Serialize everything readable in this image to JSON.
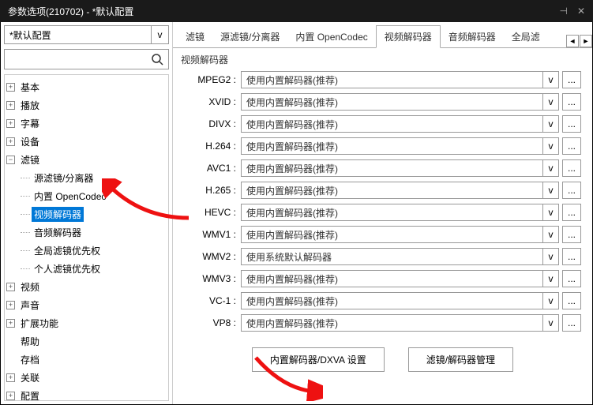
{
  "window": {
    "title": "参数选项(210702) - *默认配置"
  },
  "config_select": {
    "text": "*默认配置",
    "dropdown": "v"
  },
  "search": {
    "placeholder": ""
  },
  "tree": {
    "items": [
      {
        "toggle": "+",
        "label": "基本"
      },
      {
        "toggle": "+",
        "label": "播放"
      },
      {
        "toggle": "+",
        "label": "字幕"
      },
      {
        "toggle": "+",
        "label": "设备"
      },
      {
        "toggle": "−",
        "label": "滤镜",
        "children": [
          {
            "label": "源滤镜/分离器"
          },
          {
            "label": "内置 OpenCodec"
          },
          {
            "label": "视频解码器",
            "selected": true
          },
          {
            "label": "音频解码器"
          },
          {
            "label": "全局滤镜优先权"
          },
          {
            "label": "个人滤镜优先权"
          }
        ]
      },
      {
        "toggle": "+",
        "label": "视频"
      },
      {
        "toggle": "+",
        "label": "声音"
      },
      {
        "toggle": "+",
        "label": "扩展功能"
      },
      {
        "toggle": "",
        "label": "帮助"
      },
      {
        "toggle": "",
        "label": "存档"
      },
      {
        "toggle": "+",
        "label": "关联"
      },
      {
        "toggle": "+",
        "label": "配置"
      }
    ]
  },
  "tabs": {
    "items": [
      {
        "label": "滤镜"
      },
      {
        "label": "源滤镜/分离器"
      },
      {
        "label": "内置 OpenCodec"
      },
      {
        "label": "视频解码器",
        "active": true
      },
      {
        "label": "音频解码器"
      },
      {
        "label": "全局滤"
      }
    ],
    "scroll_left": "◄",
    "scroll_right": "►"
  },
  "section_title": "视频解码器",
  "decoders": [
    {
      "label": "MPEG2 :",
      "value": "使用内置解码器(推荐)"
    },
    {
      "label": "XVID :",
      "value": "使用内置解码器(推荐)"
    },
    {
      "label": "DIVX :",
      "value": "使用内置解码器(推荐)"
    },
    {
      "label": "H.264 :",
      "value": "使用内置解码器(推荐)"
    },
    {
      "label": "AVC1 :",
      "value": "使用内置解码器(推荐)"
    },
    {
      "label": "H.265 :",
      "value": "使用内置解码器(推荐)"
    },
    {
      "label": "HEVC :",
      "value": "使用内置解码器(推荐)"
    },
    {
      "label": "WMV1 :",
      "value": "使用内置解码器(推荐)"
    },
    {
      "label": "WMV2 :",
      "value": "使用系统默认解码器"
    },
    {
      "label": "WMV3 :",
      "value": "使用内置解码器(推荐)"
    },
    {
      "label": "VC-1 :",
      "value": "使用内置解码器(推荐)"
    },
    {
      "label": "VP8 :",
      "value": "使用内置解码器(推荐)"
    }
  ],
  "dropdown_caret": "v",
  "more_btn": "...",
  "buttons": {
    "dxva": "内置解码器/DXVA 设置",
    "filter_mgmt": "滤镜/解码器管理"
  }
}
